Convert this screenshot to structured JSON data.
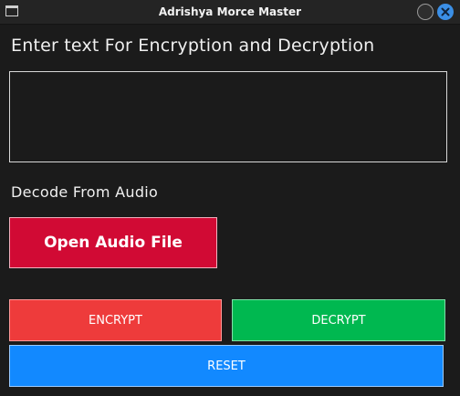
{
  "window": {
    "title": "Adrishya Morce Master",
    "icons": {
      "app": "window-icon",
      "minimize": "circle-icon",
      "close": "close-icon"
    }
  },
  "main": {
    "heading": "Enter text For Encryption and Decryption",
    "input_value": "",
    "audio_section_label": "Decode From Audio",
    "open_audio_label": "Open Audio File"
  },
  "actions": {
    "encrypt_label": "ENCRYPT",
    "decrypt_label": "DECRYPT",
    "reset_label": "RESET"
  },
  "colors": {
    "background": "#1b1b1b",
    "open_audio": "#d10a34",
    "encrypt": "#ee3b3b",
    "decrypt": "#00b850",
    "reset": "#1289ff"
  }
}
